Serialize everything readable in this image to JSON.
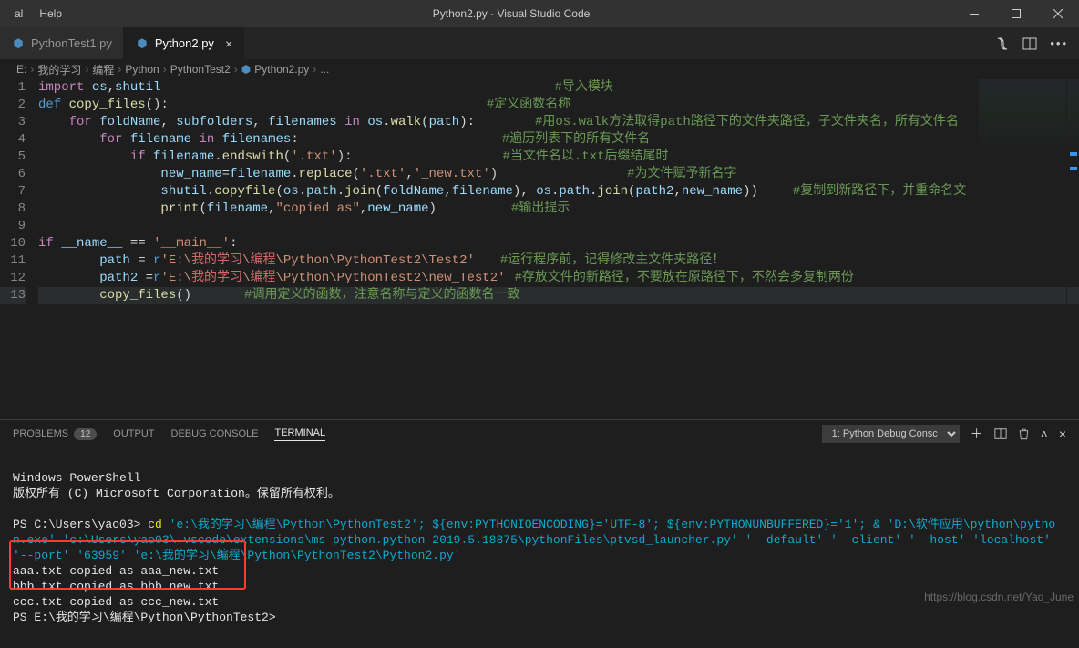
{
  "window": {
    "menu": [
      "al",
      "Help"
    ],
    "title": "Python2.py - Visual Studio Code"
  },
  "tabs": [
    {
      "label": "PythonTest1.py",
      "active": false
    },
    {
      "label": "Python2.py",
      "active": true
    }
  ],
  "breadcrumb": [
    "E:",
    "我的学习",
    "编程",
    "Python",
    "PythonTest2",
    "Python2.py",
    "..."
  ],
  "code": {
    "lines": [
      {
        "n": 1,
        "seg": [
          [
            "kw",
            "import"
          ],
          [
            "pl",
            " "
          ],
          [
            "var",
            "os"
          ],
          [
            "op",
            ","
          ],
          [
            "var",
            "shutil"
          ],
          [
            "pad",
            432
          ],
          [
            "cmt",
            "#导入模块"
          ]
        ]
      },
      {
        "n": 2,
        "seg": [
          [
            "kw2",
            "def"
          ],
          [
            "pl",
            " "
          ],
          [
            "fn",
            "copy_files"
          ],
          [
            "op",
            "():"
          ],
          [
            "pad",
            349
          ],
          [
            "cmt",
            "#定义函数名称"
          ]
        ]
      },
      {
        "n": 3,
        "seg": [
          [
            "pl",
            "    "
          ],
          [
            "kw",
            "for"
          ],
          [
            "pl",
            " "
          ],
          [
            "var",
            "foldName"
          ],
          [
            "op",
            ", "
          ],
          [
            "var",
            "subfolders"
          ],
          [
            "op",
            ", "
          ],
          [
            "var",
            "filenames"
          ],
          [
            "pl",
            " "
          ],
          [
            "kw",
            "in"
          ],
          [
            "pl",
            " "
          ],
          [
            "var",
            "os"
          ],
          [
            "op",
            "."
          ],
          [
            "fn",
            "walk"
          ],
          [
            "op",
            "("
          ],
          [
            "var",
            "path"
          ],
          [
            "op",
            "):"
          ],
          [
            "pad",
            66
          ],
          [
            "cmt",
            "#用os.walk方法取得path路径下的文件夹路径，子文件夹名，所有文件名"
          ]
        ]
      },
      {
        "n": 4,
        "seg": [
          [
            "pl",
            "        "
          ],
          [
            "kw",
            "for"
          ],
          [
            "pl",
            " "
          ],
          [
            "var",
            "filename"
          ],
          [
            "pl",
            " "
          ],
          [
            "kw",
            "in"
          ],
          [
            "pl",
            " "
          ],
          [
            "var",
            "filenames"
          ],
          [
            "op",
            ":"
          ],
          [
            "pad",
            223
          ],
          [
            "cmt",
            "#遍历列表下的所有文件名"
          ]
        ]
      },
      {
        "n": 5,
        "seg": [
          [
            "pl",
            "            "
          ],
          [
            "kw",
            "if"
          ],
          [
            "pl",
            " "
          ],
          [
            "var",
            "filename"
          ],
          [
            "op",
            "."
          ],
          [
            "fn",
            "endswith"
          ],
          [
            "op",
            "("
          ],
          [
            "str",
            "'.txt'"
          ],
          [
            "op",
            "):"
          ],
          [
            "pad",
            165
          ],
          [
            "cmt",
            "#当文件名以.txt后缀结尾时"
          ]
        ]
      },
      {
        "n": 6,
        "seg": [
          [
            "pl",
            "                "
          ],
          [
            "var",
            "new_name"
          ],
          [
            "op",
            "="
          ],
          [
            "var",
            "filename"
          ],
          [
            "op",
            "."
          ],
          [
            "fn",
            "replace"
          ],
          [
            "op",
            "("
          ],
          [
            "str",
            "'.txt'"
          ],
          [
            "op",
            ","
          ],
          [
            "str",
            "'_new.txt'"
          ],
          [
            "op",
            ")"
          ],
          [
            "pad",
            142
          ],
          [
            "cmt",
            "#为文件赋予新名字"
          ]
        ]
      },
      {
        "n": 7,
        "seg": [
          [
            "pl",
            "                "
          ],
          [
            "var",
            "shutil"
          ],
          [
            "op",
            "."
          ],
          [
            "fn",
            "copyfile"
          ],
          [
            "op",
            "("
          ],
          [
            "var",
            "os"
          ],
          [
            "op",
            "."
          ],
          [
            "var",
            "path"
          ],
          [
            "op",
            "."
          ],
          [
            "fn",
            "join"
          ],
          [
            "op",
            "("
          ],
          [
            "var",
            "foldName"
          ],
          [
            "op",
            ","
          ],
          [
            "var",
            "filename"
          ],
          [
            "op",
            "), "
          ],
          [
            "var",
            "os"
          ],
          [
            "op",
            "."
          ],
          [
            "var",
            "path"
          ],
          [
            "op",
            "."
          ],
          [
            "fn",
            "join"
          ],
          [
            "op",
            "("
          ],
          [
            "var",
            "path2"
          ],
          [
            "op",
            ","
          ],
          [
            "var",
            "new_name"
          ],
          [
            "op",
            "))"
          ],
          [
            "pad",
            38
          ],
          [
            "cmt",
            "#复制到新路径下，并重命名文"
          ]
        ]
      },
      {
        "n": 8,
        "seg": [
          [
            "pl",
            "                "
          ],
          [
            "fn",
            "print"
          ],
          [
            "op",
            "("
          ],
          [
            "var",
            "filename"
          ],
          [
            "op",
            ","
          ],
          [
            "str",
            "\"copied as\""
          ],
          [
            "op",
            ","
          ],
          [
            "var",
            "new_name"
          ],
          [
            "op",
            ")"
          ],
          [
            "pad",
            82
          ],
          [
            "cmt",
            "#输出提示"
          ]
        ]
      },
      {
        "n": 9,
        "seg": []
      },
      {
        "n": 10,
        "seg": [
          [
            "kw",
            "if"
          ],
          [
            "pl",
            " "
          ],
          [
            "var",
            "__name__"
          ],
          [
            "pl",
            " "
          ],
          [
            "op",
            "=="
          ],
          [
            "pl",
            " "
          ],
          [
            "str",
            "'__main__'"
          ],
          [
            "op",
            ":"
          ]
        ]
      },
      {
        "n": 11,
        "seg": [
          [
            "pl",
            "        "
          ],
          [
            "var",
            "path"
          ],
          [
            "pl",
            " "
          ],
          [
            "op",
            "="
          ],
          [
            "pl",
            " "
          ],
          [
            "kw2",
            "r"
          ],
          [
            "str",
            "'E:\\"
          ],
          [
            "strP",
            "我的学习"
          ],
          [
            "str",
            "\\"
          ],
          [
            "strP",
            "编程"
          ],
          [
            "str",
            "\\Python\\PythonTest2\\Test2'"
          ],
          [
            "pad",
            28
          ],
          [
            "cmt",
            "#运行程序前，记得修改主文件夹路径！"
          ]
        ]
      },
      {
        "n": 12,
        "seg": [
          [
            "pl",
            "        "
          ],
          [
            "var",
            "path2"
          ],
          [
            "pl",
            " "
          ],
          [
            "op",
            "="
          ],
          [
            "kw2",
            "r"
          ],
          [
            "str",
            "'E:\\"
          ],
          [
            "strP",
            "我的学习"
          ],
          [
            "str",
            "\\"
          ],
          [
            "strP",
            "编程"
          ],
          [
            "str",
            "\\Python\\PythonTest2\\new_Test2'"
          ],
          [
            "pad",
            10
          ],
          [
            "cmt",
            "#存放文件的新路径，不要放在原路径下，不然会多复制两份"
          ]
        ]
      },
      {
        "n": 13,
        "hl": true,
        "seg": [
          [
            "pl",
            "        "
          ],
          [
            "fn",
            "copy_files"
          ],
          [
            "op",
            "()"
          ],
          [
            "pad",
            58
          ],
          [
            "cmt",
            "#调用定义的函数，注意名称与定义的函数名一致"
          ]
        ]
      }
    ]
  },
  "panel": {
    "tabs": {
      "problems": "PROBLEMS",
      "problems_count": "12",
      "output": "OUTPUT",
      "debug": "DEBUG CONSOLE",
      "terminal": "TERMINAL"
    },
    "terminal_select": "1: Python Debug Consc"
  },
  "terminal": {
    "l1": "Windows PowerShell",
    "l2": "版权所有 (C) Microsoft Corporation。保留所有权利。",
    "prompt1_a": "PS C:\\Users\\yao03>",
    "prompt1_b": " cd ",
    "prompt1_c": "'e:\\我的学习\\编程\\Python\\PythonTest2'; ${env:PYTHONIOENCODING}='UTF-8'; ${env:PYTHONUNBUFFERED}='1'; & 'D:\\软件应用\\python\\python.exe' 'c:\\Users\\yao03\\.vscode\\extensions\\ms-python.python-2019.5.18875\\pythonFiles\\ptvsd_launcher.py' '--default' '--client' '--host' 'localhost' '--port' '63959' 'e:\\我的学习\\编程\\Python\\PythonTest2\\Python2.py'",
    "out1": "aaa.txt copied as aaa_new.txt",
    "out2": "bbb.txt copied as bbb_new.txt",
    "out3": "ccc.txt copied as ccc_new.txt",
    "prompt2": "PS E:\\我的学习\\编程\\Python\\PythonTest2>"
  },
  "watermark": "https://blog.csdn.net/Yao_June"
}
